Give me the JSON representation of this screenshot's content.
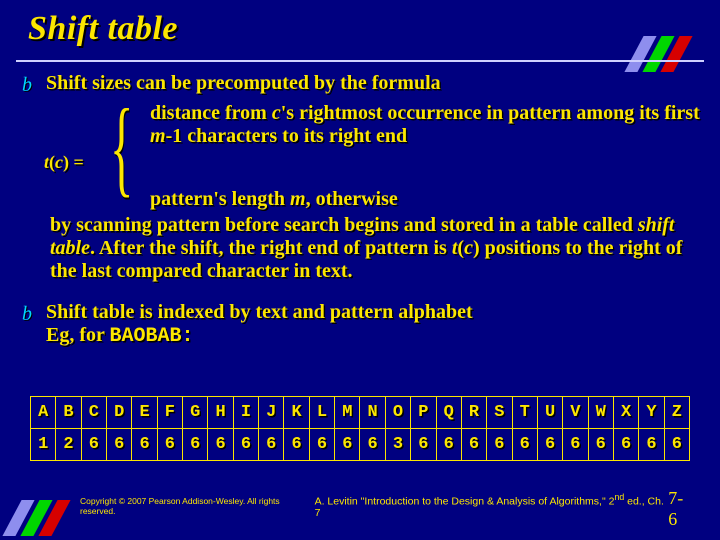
{
  "colors": {
    "background": "#000080",
    "text": "#fce600",
    "accent1": "#8e8eee",
    "accent2": "#00d600",
    "accent3": "#d60000",
    "bullet": "#00d6ff"
  },
  "title": "Shift table",
  "bullet_glyph": "b",
  "bullet1": {
    "intro": "Shift sizes can be precomputed by the formula",
    "t_of_c_prefix": "t",
    "t_of_c_paren_open": "(",
    "t_of_c_var": "c",
    "t_of_c_paren_close": ") =",
    "case1_pre": "distance from ",
    "case1_c": "c",
    "case1_mid": "'s rightmost occurrence in pattern among its first ",
    "case1_m": "m",
    "case1_post": "-1 characters to its right end",
    "case2_pre": "pattern's length ",
    "case2_m": "m",
    "case2_post": ", otherwise",
    "after_pre": "by scanning pattern before search begins and stored in a table called ",
    "after_shift_table": "shift table",
    "after_mid1": ". After the shift, the right end of pattern is ",
    "after_t": "t",
    "after_paren_open": "(",
    "after_c": "c",
    "after_paren_close": ")",
    "after_post": " positions to the right of the last compared character in text."
  },
  "bullet2": {
    "line_a": "Shift table is indexed by text and pattern alphabet",
    "line_b_pre": "Eg, for ",
    "line_b_mono": "BAOBAB:"
  },
  "table": {
    "headers": [
      "A",
      "B",
      "C",
      "D",
      "E",
      "F",
      "G",
      "H",
      "I",
      "J",
      "K",
      "L",
      "M",
      "N",
      "O",
      "P",
      "Q",
      "R",
      "S",
      "T",
      "U",
      "V",
      "W",
      "X",
      "Y",
      "Z"
    ],
    "values": [
      "1",
      "2",
      "6",
      "6",
      "6",
      "6",
      "6",
      "6",
      "6",
      "6",
      "6",
      "6",
      "6",
      "6",
      "3",
      "6",
      "6",
      "6",
      "6",
      "6",
      "6",
      "6",
      "6",
      "6",
      "6",
      "6"
    ]
  },
  "footer": {
    "copyright": "Copyright © 2007 Pearson Addison-Wesley. All rights reserved.",
    "citation_pre": "A. Levitin \"Introduction to the Design & Analysis of Algorithms,\" 2",
    "citation_sup": "nd",
    "citation_post": " ed., Ch. 7",
    "page": "7-6"
  }
}
